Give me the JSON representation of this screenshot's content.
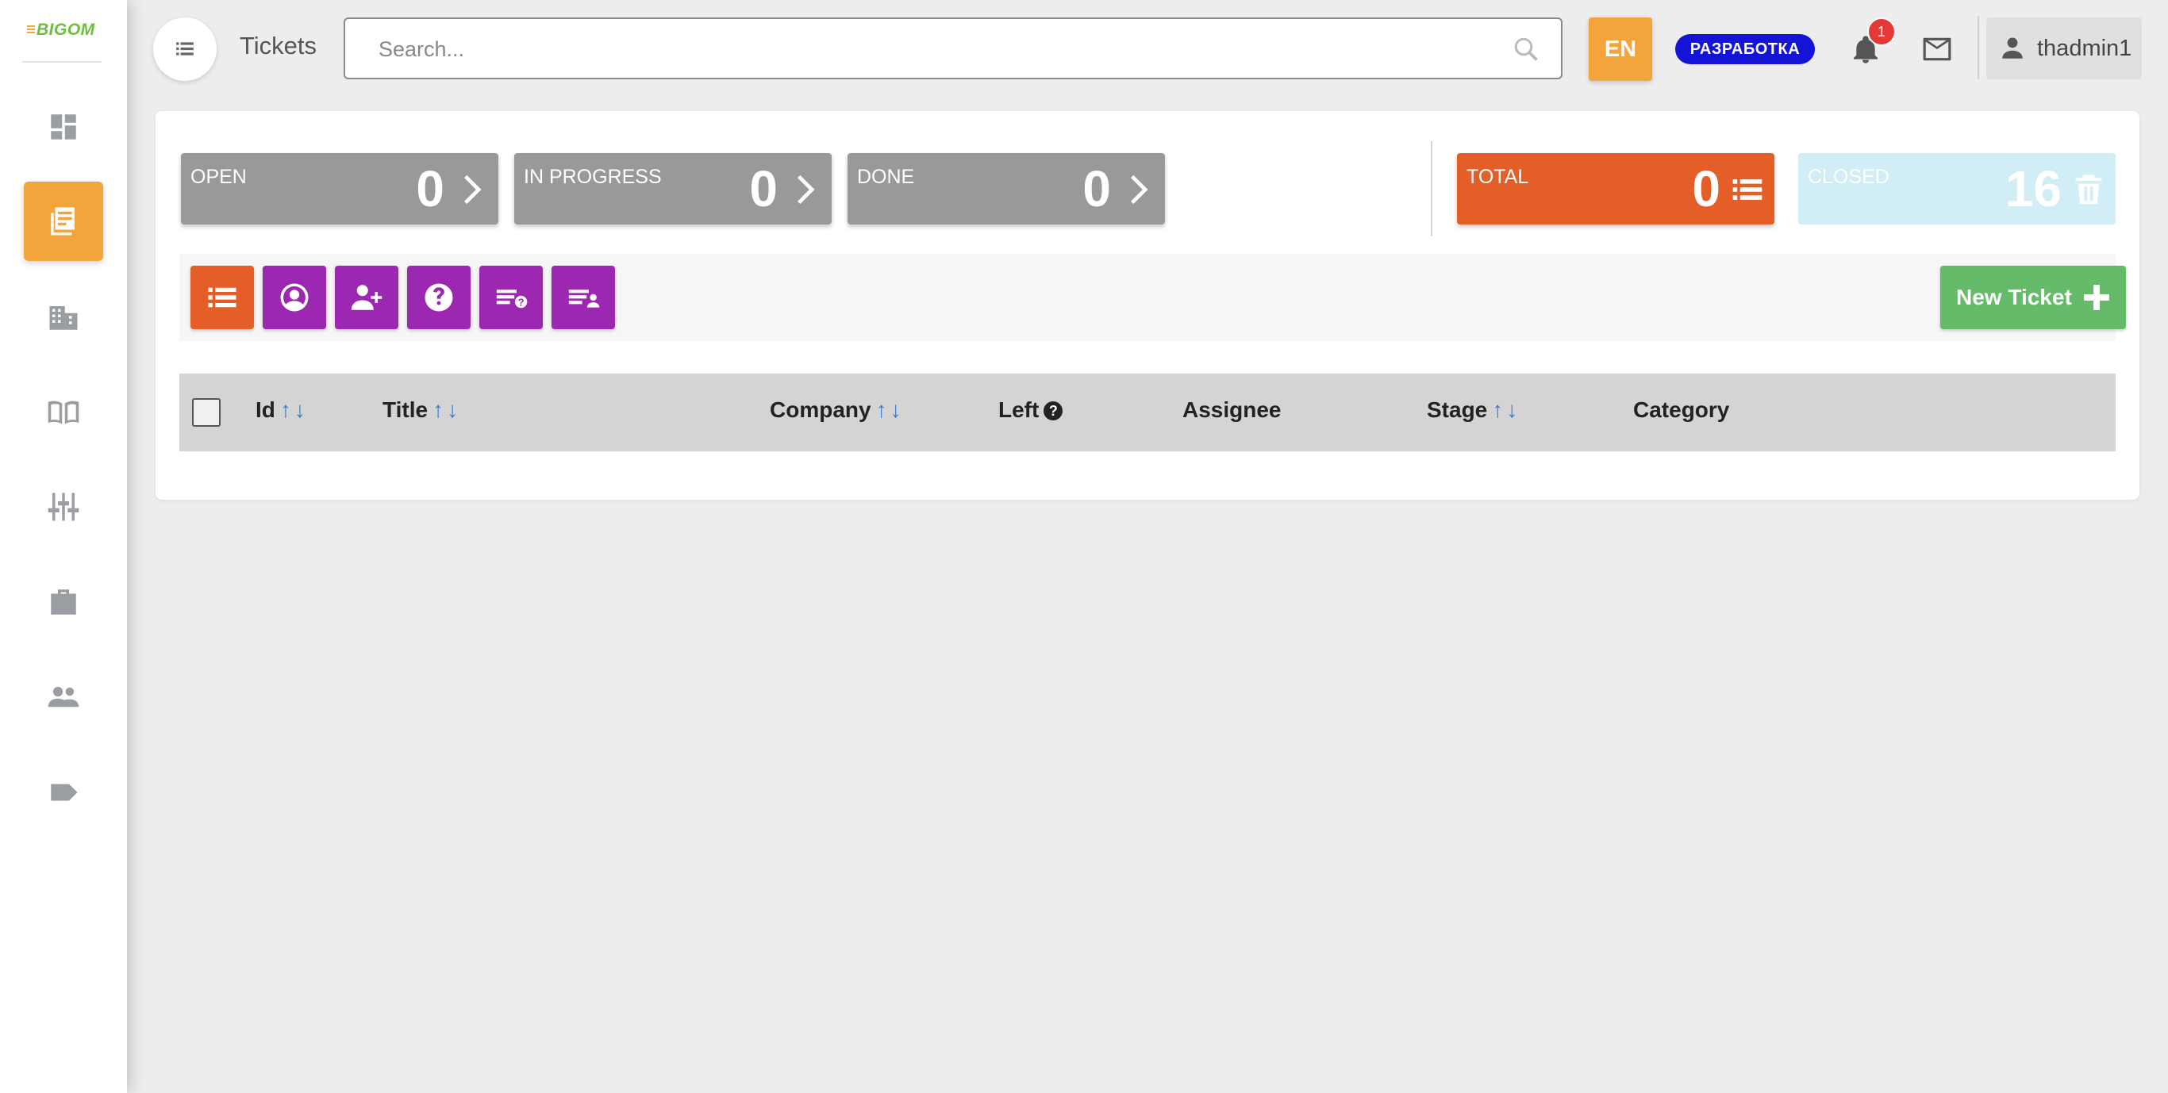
{
  "sidebar": {
    "logo_text": "BIGOM",
    "items": [
      {
        "icon": "dashboard-icon",
        "active": false
      },
      {
        "icon": "tickets-icon",
        "active": true
      },
      {
        "icon": "buildings-icon",
        "active": false
      },
      {
        "icon": "book-icon",
        "active": false
      },
      {
        "icon": "sliders-icon",
        "active": false
      },
      {
        "icon": "briefcase-icon",
        "active": false
      },
      {
        "icon": "users-icon",
        "active": false
      },
      {
        "icon": "tag-icon",
        "active": false
      }
    ]
  },
  "header": {
    "title": "Tickets",
    "search_placeholder": "Search...",
    "lang": "EN",
    "env_badge": "РАЗРАБОТКА",
    "notifications_count": "1",
    "username": "thadmin1"
  },
  "stats": {
    "open": {
      "label": "OPEN",
      "value": "0"
    },
    "in_progress": {
      "label": "IN PROGRESS",
      "value": "0"
    },
    "done": {
      "label": "DONE",
      "value": "0"
    },
    "total": {
      "label": "TOTAL",
      "value": "0"
    },
    "closed": {
      "label": "CLOSED",
      "value": "16"
    }
  },
  "toolbar": {
    "new_ticket_label": "New Ticket"
  },
  "table": {
    "columns": {
      "id": "Id",
      "title": "Title",
      "company": "Company",
      "left": "Left",
      "assignee": "Assignee",
      "stage": "Stage",
      "category": "Category"
    },
    "sort_arrows": "↑↓",
    "rows": []
  },
  "colors": {
    "accent_orange": "#f3a43b",
    "total_orange": "#e45f27",
    "filter_purple": "#9c27b0",
    "new_green": "#66bb6a",
    "env_blue": "#1414d6"
  }
}
